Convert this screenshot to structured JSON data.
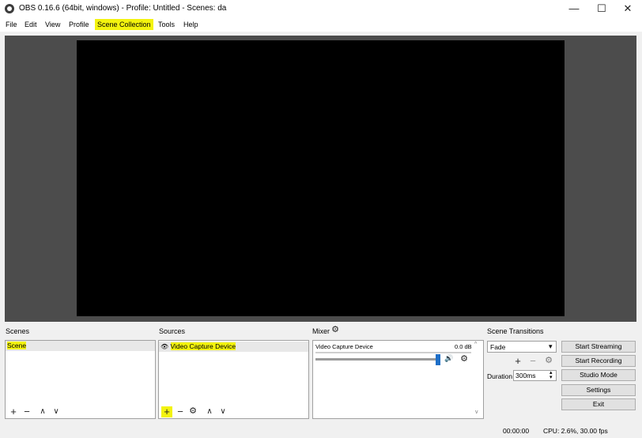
{
  "window": {
    "title": "OBS 0.16.6 (64bit, windows) - Profile: Untitled - Scenes: da",
    "minimize_glyph": "—",
    "maximize_glyph": "☐",
    "close_glyph": "✕"
  },
  "menu": {
    "items": [
      "File",
      "Edit",
      "View",
      "Profile",
      "Scene Collection",
      "Tools",
      "Help"
    ],
    "highlighted": "Scene Collection",
    "highlight_color": "#f3f30f"
  },
  "scenes": {
    "title": "Scenes",
    "items": [
      "Scene"
    ]
  },
  "sources": {
    "title": "Sources",
    "items": [
      "Video Capture Device"
    ]
  },
  "mixer": {
    "title": "Mixer",
    "channel_name": "Video Capture Device",
    "level": "0.0 dB"
  },
  "transitions": {
    "title": "Scene Transitions",
    "selected": "Fade",
    "duration_label": "Duration",
    "duration_value": "300ms"
  },
  "controls": {
    "start_streaming": "Start Streaming",
    "start_recording": "Start Recording",
    "studio_mode": "Studio Mode",
    "settings": "Settings",
    "exit": "Exit"
  },
  "status": {
    "time": "00:00:00",
    "cpu": "CPU: 2.6%, 30.00 fps"
  },
  "icons": {
    "plus": "+",
    "minus": "−",
    "up": "∧",
    "down": "∨",
    "gear": "⚙",
    "eye": "👁",
    "speaker": "🔊",
    "dropdown": "▾",
    "spin_up": "▴",
    "spin_down": "▾",
    "scroll_up": "^",
    "scroll_down": "v"
  }
}
